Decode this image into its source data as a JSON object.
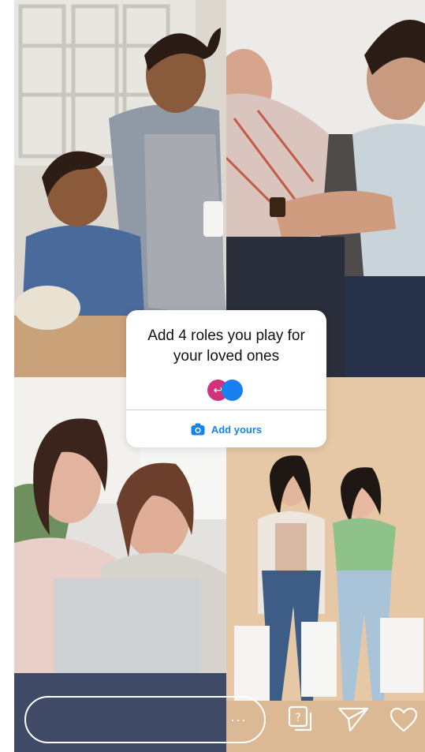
{
  "sticker": {
    "prompt": "Add 4 roles you play for your loved ones",
    "action_label": "Add yours",
    "accent_color": "#1683ef",
    "avatar_colors": [
      "#d2317c",
      "#1a7ff0"
    ]
  },
  "tiles": [
    {
      "name": "father-son-baking-photo",
      "icon": "photo"
    },
    {
      "name": "caregiver-elder-medicine-photo",
      "icon": "photo"
    },
    {
      "name": "daughters-laptop-photo",
      "icon": "photo"
    },
    {
      "name": "friends-shopping-photo",
      "icon": "photo"
    }
  ],
  "reply": {
    "dots": "···"
  },
  "icons": {
    "add_yours": "camera-icon",
    "prompt_reply": "question-sticker-icon",
    "share": "paper-plane-icon",
    "like": "heart-icon"
  }
}
